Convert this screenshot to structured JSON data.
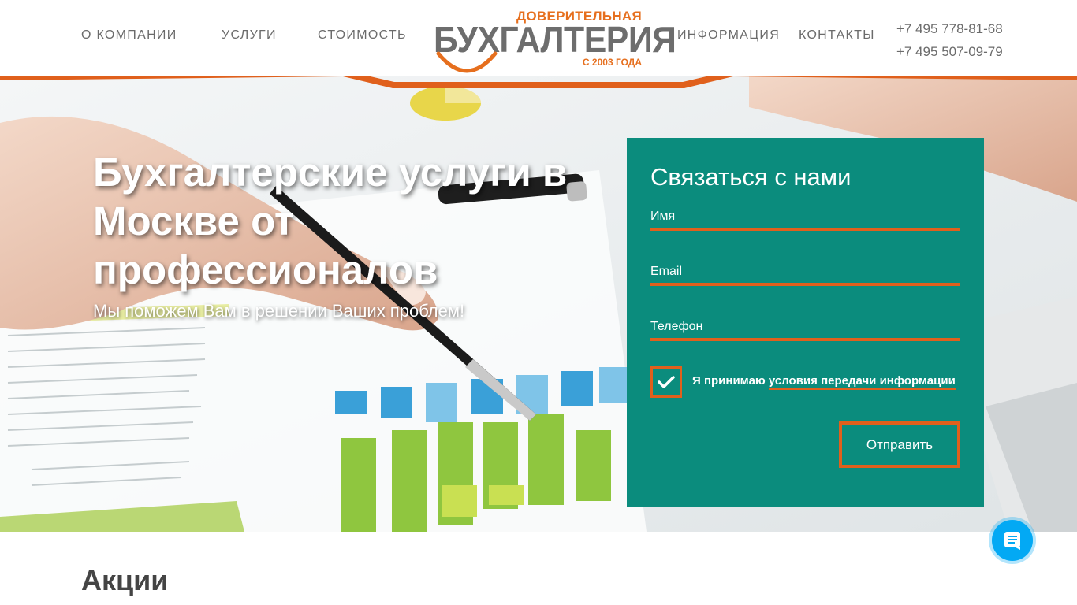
{
  "nav": {
    "items": [
      {
        "label": "О КОМПАНИИ"
      },
      {
        "label": "УСЛУГИ"
      },
      {
        "label": "СТОИМОСТЬ"
      },
      {
        "label": "ИНФОРМАЦИЯ"
      },
      {
        "label": "КОНТАКТЫ"
      }
    ]
  },
  "logo": {
    "top": "ДОВЕРИТЕЛЬНАЯ",
    "main": "БУХГАЛТЕРИЯ",
    "sub": "С 2003 ГОДА"
  },
  "phones": [
    "+7 495 778-81-68",
    "+7 495 507-09-79"
  ],
  "hero": {
    "title": "Бухгалтерские услуги в Москве от профессионалов",
    "subtitle": "Мы поможем Вам в решении Ваших проблем!"
  },
  "form": {
    "title": "Связаться с нами",
    "name_placeholder": "Имя",
    "email_placeholder": "Email",
    "phone_placeholder": "Телефон",
    "consent_prefix": "Я принимаю",
    "consent_link": "условия передачи информации",
    "consent_checked": true,
    "submit_label": "Отправить"
  },
  "section": {
    "title": "Акции"
  },
  "colors": {
    "accent": "#e0601c",
    "form_bg": "#0b8c7d",
    "chat": "#03a9f4",
    "logo_orange": "#e66f1e"
  },
  "icons": {
    "checkbox": "check-icon",
    "chat": "chat-icon"
  }
}
